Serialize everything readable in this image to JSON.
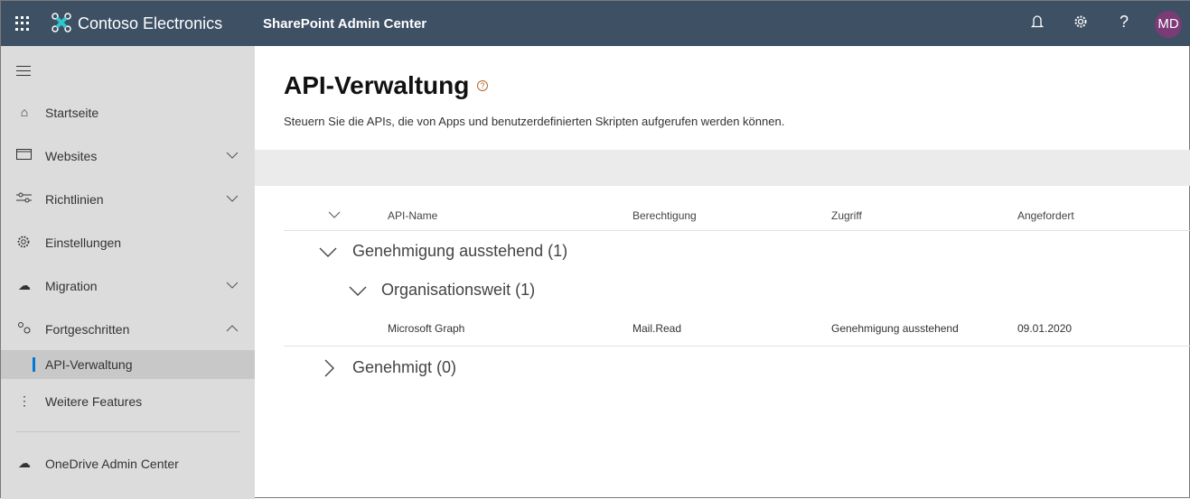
{
  "header": {
    "brand": "Contoso Electronics",
    "app_name": "SharePoint Admin Center",
    "help": "?",
    "avatar": "MD"
  },
  "sidebar": {
    "items": [
      {
        "label": "Startseite"
      },
      {
        "label": "Websites"
      },
      {
        "label": "Richtlinien"
      },
      {
        "label": "Einstellungen"
      },
      {
        "label": "Migration"
      },
      {
        "label": "Fortgeschritten"
      },
      {
        "label": "API-Verwaltung"
      },
      {
        "label": "Weitere Features"
      },
      {
        "label": "OneDrive Admin Center"
      }
    ]
  },
  "page": {
    "title": "API-Verwaltung",
    "help": "?",
    "description": "Steuern Sie die APIs, die von Apps und benutzerdefinierten Skripten aufgerufen werden können."
  },
  "table": {
    "columns": [
      "API-Name",
      "Berechtigung",
      "Zugriff",
      "Angefordert"
    ],
    "groups": [
      {
        "label": "Genehmigung ausstehend (1)"
      },
      {
        "label": "Organisationsweit (1)"
      },
      {
        "label": "Genehmigt (0)"
      }
    ],
    "rows": [
      [
        "Microsoft Graph",
        "Mail.Read",
        "Genehmigung ausstehend",
        "09.01.2020"
      ]
    ]
  },
  "colors": {
    "header": "#3d5064",
    "accent": "#0078d4",
    "avatar": "#7b3b77"
  }
}
